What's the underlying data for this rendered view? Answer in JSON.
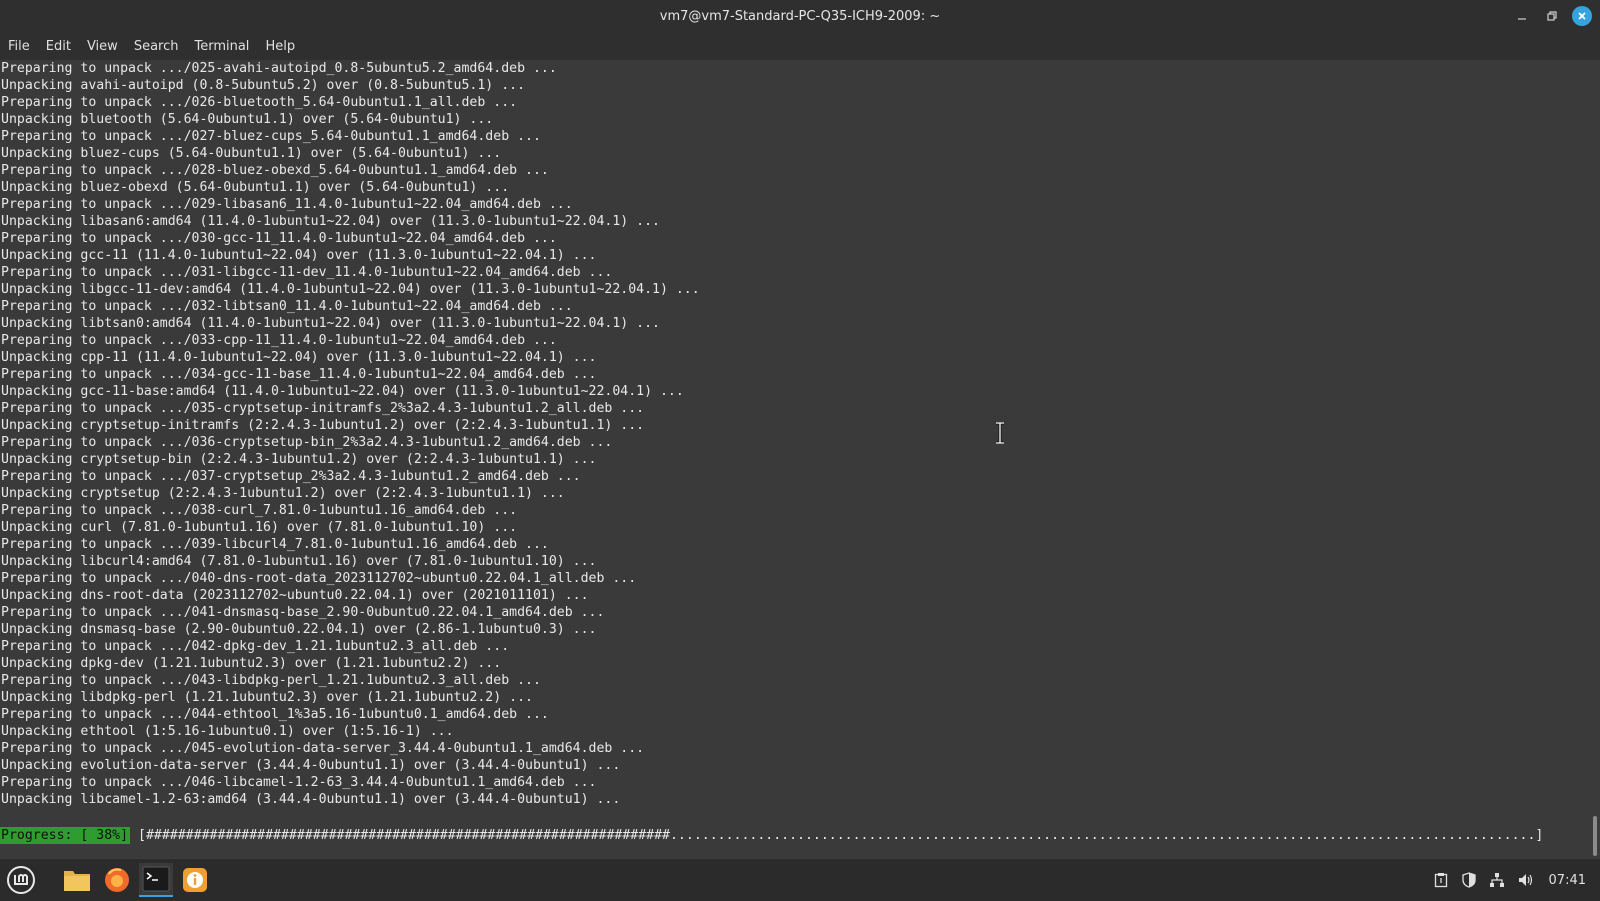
{
  "window": {
    "title": "vm7@vm7-Standard-PC-Q35-ICH9-2009: ~"
  },
  "menu": [
    "File",
    "Edit",
    "View",
    "Search",
    "Terminal",
    "Help"
  ],
  "terminal": {
    "lines": [
      "Preparing to unpack .../025-avahi-autoipd_0.8-5ubuntu5.2_amd64.deb ...",
      "Unpacking avahi-autoipd (0.8-5ubuntu5.2) over (0.8-5ubuntu5.1) ...",
      "Preparing to unpack .../026-bluetooth_5.64-0ubuntu1.1_all.deb ...",
      "Unpacking bluetooth (5.64-0ubuntu1.1) over (5.64-0ubuntu1) ...",
      "Preparing to unpack .../027-bluez-cups_5.64-0ubuntu1.1_amd64.deb ...",
      "Unpacking bluez-cups (5.64-0ubuntu1.1) over (5.64-0ubuntu1) ...",
      "Preparing to unpack .../028-bluez-obexd_5.64-0ubuntu1.1_amd64.deb ...",
      "Unpacking bluez-obexd (5.64-0ubuntu1.1) over (5.64-0ubuntu1) ...",
      "Preparing to unpack .../029-libasan6_11.4.0-1ubuntu1~22.04_amd64.deb ...",
      "Unpacking libasan6:amd64 (11.4.0-1ubuntu1~22.04) over (11.3.0-1ubuntu1~22.04.1) ...",
      "Preparing to unpack .../030-gcc-11_11.4.0-1ubuntu1~22.04_amd64.deb ...",
      "Unpacking gcc-11 (11.4.0-1ubuntu1~22.04) over (11.3.0-1ubuntu1~22.04.1) ...",
      "Preparing to unpack .../031-libgcc-11-dev_11.4.0-1ubuntu1~22.04_amd64.deb ...",
      "Unpacking libgcc-11-dev:amd64 (11.4.0-1ubuntu1~22.04) over (11.3.0-1ubuntu1~22.04.1) ...",
      "Preparing to unpack .../032-libtsan0_11.4.0-1ubuntu1~22.04_amd64.deb ...",
      "Unpacking libtsan0:amd64 (11.4.0-1ubuntu1~22.04) over (11.3.0-1ubuntu1~22.04.1) ...",
      "Preparing to unpack .../033-cpp-11_11.4.0-1ubuntu1~22.04_amd64.deb ...",
      "Unpacking cpp-11 (11.4.0-1ubuntu1~22.04) over (11.3.0-1ubuntu1~22.04.1) ...",
      "Preparing to unpack .../034-gcc-11-base_11.4.0-1ubuntu1~22.04_amd64.deb ...",
      "Unpacking gcc-11-base:amd64 (11.4.0-1ubuntu1~22.04) over (11.3.0-1ubuntu1~22.04.1) ...",
      "Preparing to unpack .../035-cryptsetup-initramfs_2%3a2.4.3-1ubuntu1.2_all.deb ...",
      "Unpacking cryptsetup-initramfs (2:2.4.3-1ubuntu1.2) over (2:2.4.3-1ubuntu1.1) ...",
      "Preparing to unpack .../036-cryptsetup-bin_2%3a2.4.3-1ubuntu1.2_amd64.deb ...",
      "Unpacking cryptsetup-bin (2:2.4.3-1ubuntu1.2) over (2:2.4.3-1ubuntu1.1) ...",
      "Preparing to unpack .../037-cryptsetup_2%3a2.4.3-1ubuntu1.2_amd64.deb ...",
      "Unpacking cryptsetup (2:2.4.3-1ubuntu1.2) over (2:2.4.3-1ubuntu1.1) ...",
      "Preparing to unpack .../038-curl_7.81.0-1ubuntu1.16_amd64.deb ...",
      "Unpacking curl (7.81.0-1ubuntu1.16) over (7.81.0-1ubuntu1.10) ...",
      "Preparing to unpack .../039-libcurl4_7.81.0-1ubuntu1.16_amd64.deb ...",
      "Unpacking libcurl4:amd64 (7.81.0-1ubuntu1.16) over (7.81.0-1ubuntu1.10) ...",
      "Preparing to unpack .../040-dns-root-data_2023112702~ubuntu0.22.04.1_all.deb ...",
      "Unpacking dns-root-data (2023112702~ubuntu0.22.04.1) over (2021011101) ...",
      "Preparing to unpack .../041-dnsmasq-base_2.90-0ubuntu0.22.04.1_amd64.deb ...",
      "Unpacking dnsmasq-base (2.90-0ubuntu0.22.04.1) over (2.86-1.1ubuntu0.3) ...",
      "Preparing to unpack .../042-dpkg-dev_1.21.1ubuntu2.3_all.deb ...",
      "Unpacking dpkg-dev (1.21.1ubuntu2.3) over (1.21.1ubuntu2.2) ...",
      "Preparing to unpack .../043-libdpkg-perl_1.21.1ubuntu2.3_all.deb ...",
      "Unpacking libdpkg-perl (1.21.1ubuntu2.3) over (1.21.1ubuntu2.2) ...",
      "Preparing to unpack .../044-ethtool_1%3a5.16-1ubuntu0.1_amd64.deb ...",
      "Unpacking ethtool (1:5.16-1ubuntu0.1) over (1:5.16-1) ...",
      "Preparing to unpack .../045-evolution-data-server_3.44.4-0ubuntu1.1_amd64.deb ...",
      "Unpacking evolution-data-server (3.44.4-0ubuntu1.1) over (3.44.4-0ubuntu1) ...",
      "Preparing to unpack .../046-libcamel-1.2-63_3.44.4-0ubuntu1.1_amd64.deb ...",
      "Unpacking libcamel-1.2-63:amd64 (3.44.4-0ubuntu1.1) over (3.44.4-0ubuntu1) ..."
    ],
    "progress_label": "Progress: [ 38%]",
    "progress_bar": "[##################################################################.............................................................................................................]",
    "progress_value": 0.38
  },
  "taskbar": {
    "apps": [
      "menu-icon",
      "files-icon",
      "firefox-icon",
      "terminal-icon",
      "update-manager-icon"
    ],
    "clock": "07:41"
  },
  "colors": {
    "terminal_bg": "#3a3a3a",
    "progress_bg": "#2e9c2e",
    "accent": "#35a3dd"
  }
}
